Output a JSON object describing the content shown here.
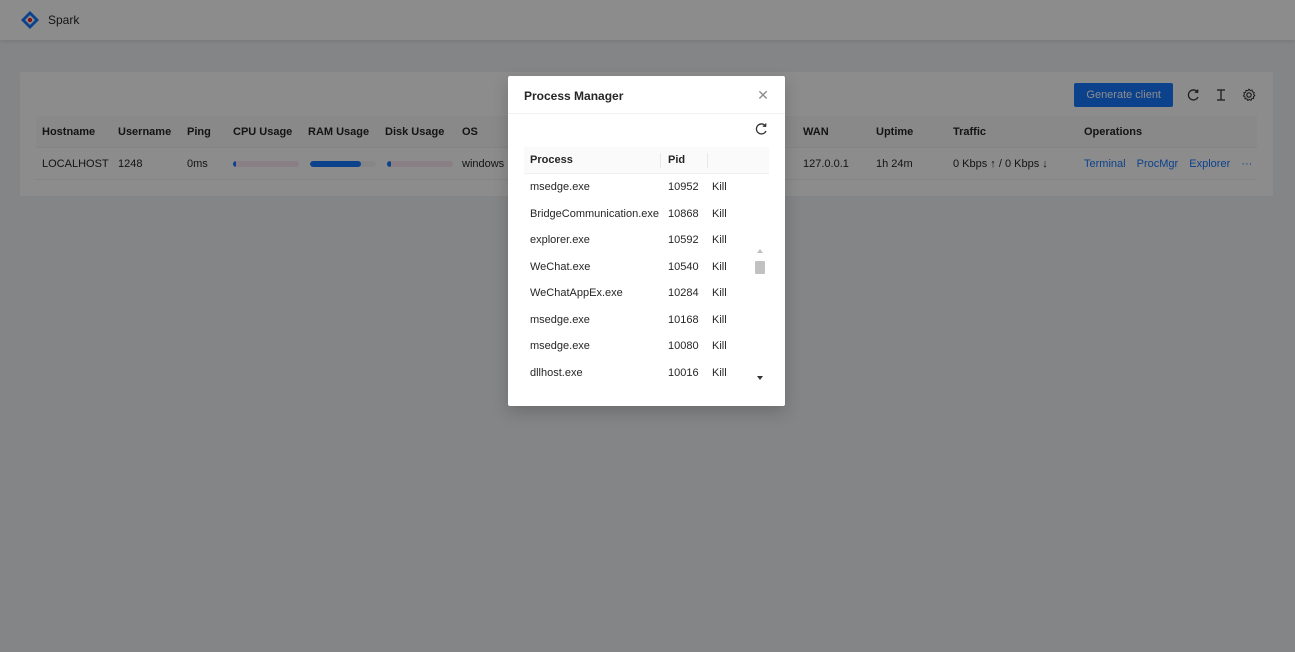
{
  "app": {
    "brand": "Spark"
  },
  "toolbar": {
    "generate_label": "Generate client",
    "icons": [
      "reload-icon",
      "text-cursor-icon",
      "settings-icon"
    ]
  },
  "table": {
    "columns": [
      "Hostname",
      "Username",
      "Ping",
      "CPU Usage",
      "RAM Usage",
      "Disk Usage",
      "OS",
      "WAN",
      "Uptime",
      "Traffic",
      "Operations"
    ],
    "row": {
      "hostname": "LOCALHOST",
      "username": "1248",
      "ping": "0ms",
      "cpu_usage": 0.02,
      "ram_usage": 0.78,
      "disk_usage": 0.06,
      "os": "windows",
      "wan": "127.0.0.1",
      "uptime": "1h 24m",
      "traffic": "0 Kbps ↑ / 0 Kbps ↓",
      "operations": [
        "Terminal",
        "ProcMgr",
        "Explorer",
        "···"
      ]
    }
  },
  "modal": {
    "title": "Process Manager",
    "columns": [
      "Process",
      "Pid"
    ],
    "action_label": "Kill",
    "processes": [
      {
        "name": "msedge.exe",
        "pid": "10952"
      },
      {
        "name": "BridgeCommunication.exe",
        "pid": "10868"
      },
      {
        "name": "explorer.exe",
        "pid": "10592"
      },
      {
        "name": "WeChat.exe",
        "pid": "10540"
      },
      {
        "name": "WeChatAppEx.exe",
        "pid": "10284"
      },
      {
        "name": "msedge.exe",
        "pid": "10168"
      },
      {
        "name": "msedge.exe",
        "pid": "10080"
      },
      {
        "name": "dllhost.exe",
        "pid": "10016"
      }
    ]
  },
  "colors": {
    "accent": "#1677ff",
    "mask": "rgba(0,0,0,0.45)"
  }
}
